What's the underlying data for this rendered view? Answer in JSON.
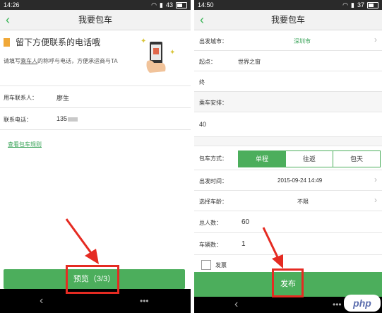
{
  "left": {
    "status": {
      "time": "14:26",
      "battery": "43"
    },
    "title": "我要包车",
    "promo": {
      "heading": "留下方便联系的电话哦",
      "desc_1": "请填写",
      "desc_link": "乘车人",
      "desc_2": "的称呼与电话，方便承运商与TA"
    },
    "contact": {
      "label": "用车联系人：",
      "value": "廖生"
    },
    "phone": {
      "label": "联系电话：",
      "value": "135"
    },
    "rules_link": "查看包车规则",
    "preview_button": "预览（3/3）"
  },
  "right": {
    "status": {
      "time": "14:50",
      "battery": "37"
    },
    "title": "我要包车",
    "depart_city": {
      "label": "出发城市：",
      "value": "深圳市"
    },
    "start": {
      "label": "起点：",
      "value": "世界之窗"
    },
    "end": {
      "label": "终"
    },
    "arrangement": {
      "label": "乘车安排：",
      "value": "40"
    },
    "trip_type": {
      "label": "包车方式：",
      "options": [
        "单程",
        "往返",
        "包天"
      ],
      "selected": 0
    },
    "depart_time": {
      "label": "出发时间：",
      "value": "2015-09-24 14:49"
    },
    "vehicle_age": {
      "label": "选择车龄：",
      "value": "不限"
    },
    "total_people": {
      "label": "总人数：",
      "value": "60"
    },
    "vehicle_count": {
      "label": "车辆数：",
      "value": "1"
    },
    "invoice": {
      "label": "发票"
    },
    "publish_button": "发布"
  },
  "accent_color": "#4cae5c",
  "annotation_color": "#e52b22",
  "watermark": "php"
}
